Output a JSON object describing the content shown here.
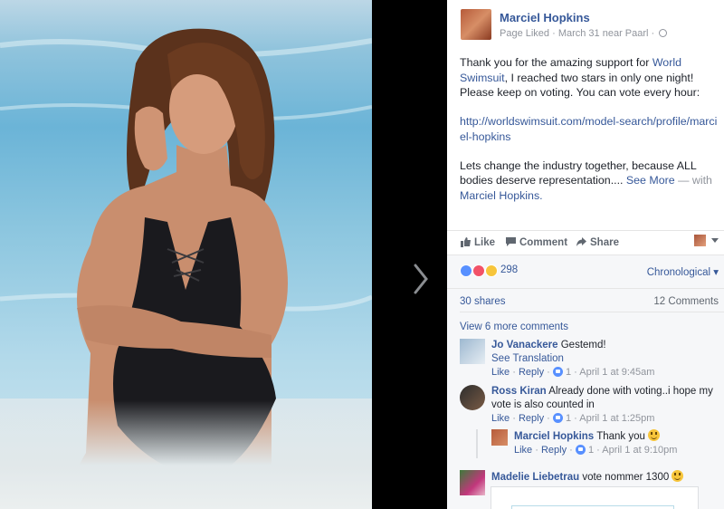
{
  "post": {
    "page_name": "Marciel Hopkins",
    "meta": "Page Liked · March 31 near Paarl ·",
    "text_p1_a": "Thank you for the amazing support for ",
    "text_p1_link": "World Swimsuit",
    "text_p1_b": ", I reached two stars in only one night! Please keep on voting. You can vote every hour:",
    "url": "http://worldswimsuit.com/model-search/profile/marciel-hopkins",
    "text_p3": "Lets change the industry together, because ALL bodies deserve representation.... ",
    "see_more": "See More",
    "with": " — with ",
    "with_name": "Marciel Hopkins."
  },
  "actions": {
    "like": "Like",
    "comment": "Comment",
    "share": "Share"
  },
  "stats": {
    "reaction_count": "298",
    "sort": "Chronological",
    "shares": "30 shares",
    "comments": "12 Comments",
    "view_more": "View 6 more comments"
  },
  "comments": [
    {
      "name": "Jo Vanackere",
      "text": "Gestemd!",
      "extra": "See Translation",
      "like": "Like",
      "reply": "Reply",
      "likes": "1",
      "time": "April 1 at 9:45am"
    },
    {
      "name": "Ross Kiran",
      "text": "Already done with voting..i hope my vote is also counted in",
      "like": "Like",
      "reply": "Reply",
      "likes": "1",
      "time": "April 1 at 1:25pm"
    },
    {
      "name": "Marciel Hopkins",
      "text": "Thank you",
      "like": "Like",
      "reply": "Reply",
      "likes": "1",
      "time": "April 1 at 9:10pm"
    },
    {
      "name": "Madelie Liebetrau",
      "text": "vote nommer 1300"
    }
  ],
  "colors": {
    "link": "#365899",
    "meta": "#90949c",
    "panel_bg": "#f6f7f9",
    "like_blue": "#5890ff",
    "love_red": "#f25268",
    "wow_yellow": "#f7c53b"
  },
  "icons": [
    "globe-icon",
    "thumbs-up-icon",
    "comment-icon",
    "share-icon",
    "chevron-right-icon",
    "like-reaction-icon",
    "love-reaction-icon",
    "wow-reaction-icon",
    "smile-emoji-icon"
  ]
}
